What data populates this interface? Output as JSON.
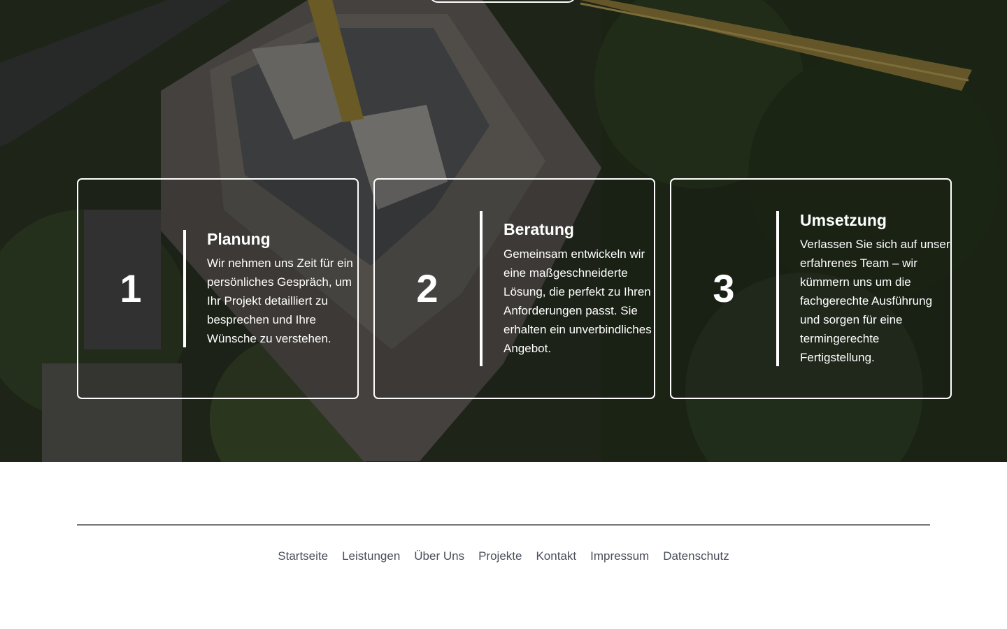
{
  "steps": [
    {
      "number": "1",
      "title": "Planung",
      "description": "Wir nehmen uns Zeit für ein persönliches Gespräch, um Ihr Projekt detailliert zu besprechen und Ihre Wünsche zu verstehen."
    },
    {
      "number": "2",
      "title": "Beratung",
      "description": "Gemeinsam entwickeln wir eine maßgeschneiderte Lösung, die perfekt zu Ihren Anforderungen passt. Sie erhalten ein unverbindliches Angebot."
    },
    {
      "number": "3",
      "title": "Umsetzung",
      "description": "Verlassen Sie sich auf unser erfahrenes Team – wir kümmern uns um die fachgerechte Ausführung und sorgen für eine termingerechte Fertigstellung."
    }
  ],
  "footer": {
    "links": [
      "Startseite",
      "Leistungen",
      "Über Uns",
      "Projekte",
      "Kontakt",
      "Impressum",
      "Datenschutz"
    ]
  },
  "colors": {
    "footer_link": "#4a4f5a",
    "rule": "#777777",
    "card_border": "#ffffff"
  }
}
